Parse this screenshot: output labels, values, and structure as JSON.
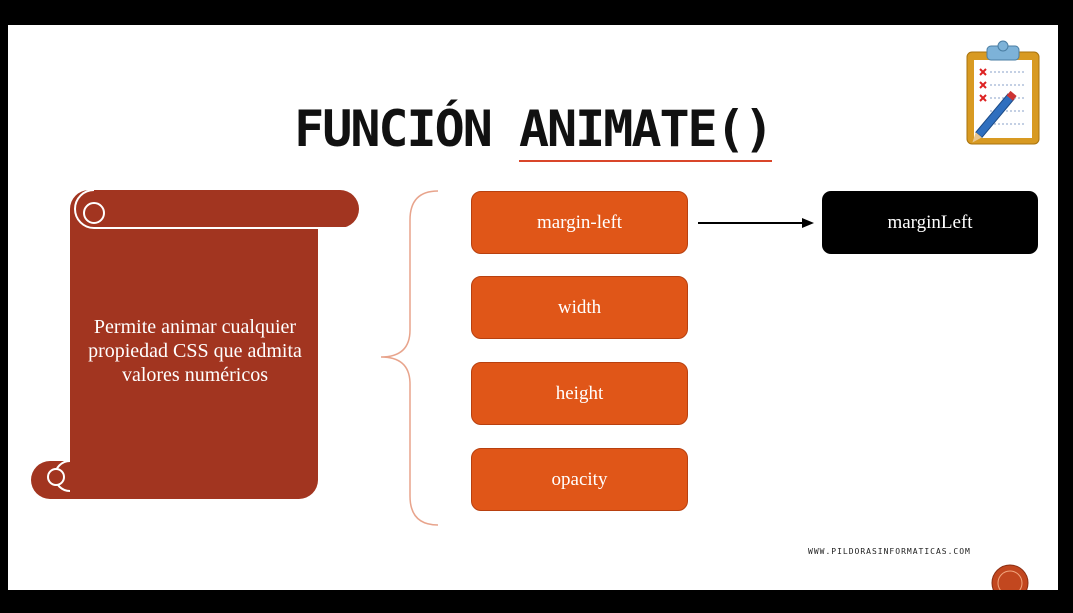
{
  "slide": {
    "title_part1": "FUNCIÓN ",
    "title_part2": "ANIMATE()",
    "scroll_text": "Permite animar cualquier propiedad CSS que admita valores numéricos",
    "properties": [
      "margin-left",
      "width",
      "height",
      "opacity"
    ],
    "camel_case_result": "marginLeft",
    "website": "WWW.PILDORASINFORMATICAS.COM"
  },
  "colors": {
    "scroll": "#a23520",
    "property_box": "#e05618",
    "result_box": "#000000",
    "brace": "#e8a48c",
    "title_underline": "#d9462a"
  },
  "icons": [
    "clipboard-checklist-icon",
    "logo-icon"
  ]
}
